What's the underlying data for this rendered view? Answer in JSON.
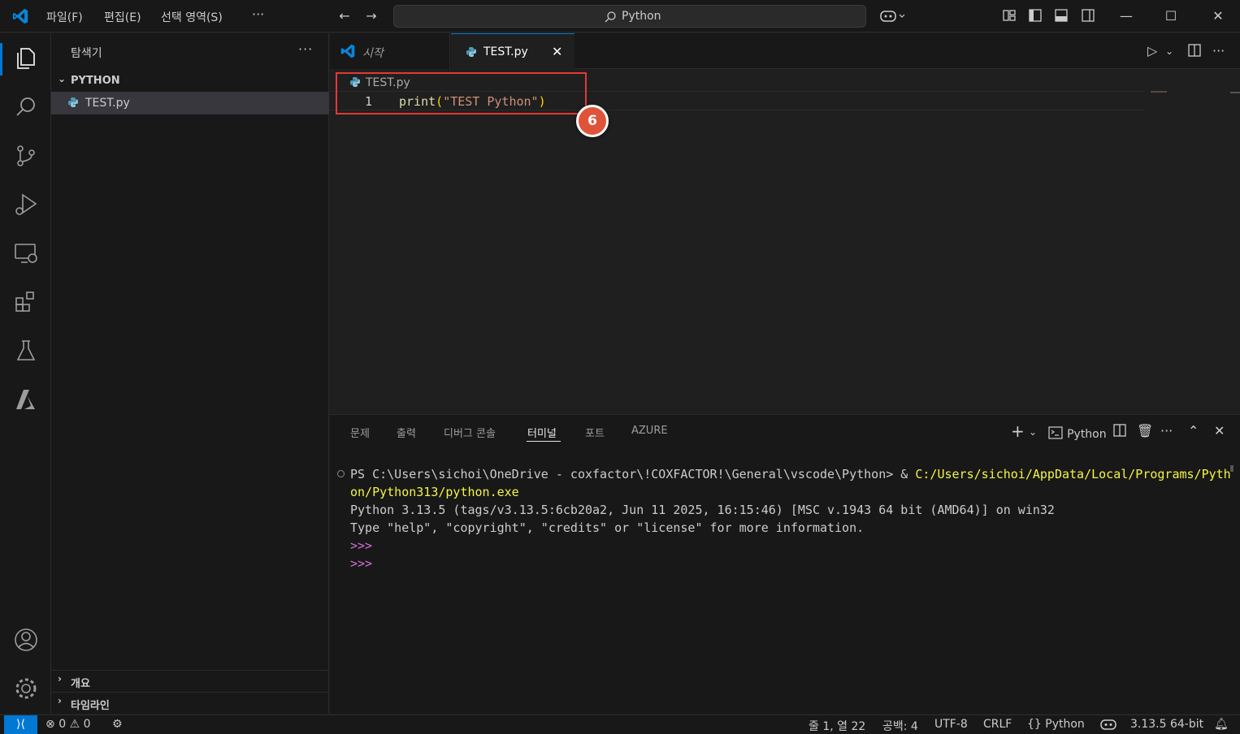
{
  "titlebar": {
    "menus": [
      "파일(F)",
      "편집(E)",
      "선택 영역(S)"
    ],
    "more": "···",
    "search_label": "Python",
    "icons": [
      "vscode-logo",
      "back-arrow-icon",
      "forward-arrow-icon",
      "search-icon",
      "copilot-icon",
      "customize-layout-icon",
      "toggle-sidebar-icon",
      "toggle-panel-icon",
      "toggle-secondary-sidebar-icon",
      "minimize-icon",
      "maximize-icon",
      "close-icon"
    ]
  },
  "activitybar": {
    "items": [
      "explorer-icon",
      "search-icon",
      "source-control-icon",
      "run-debug-icon",
      "remote-explorer-icon",
      "extensions-icon",
      "testing-icon",
      "azure-icon",
      "accounts-icon",
      "settings-gear-icon"
    ]
  },
  "sidebar": {
    "title": "탐색기",
    "more": "···",
    "folder": "PYTHON",
    "file": "TEST.py",
    "outline": "개요",
    "timeline": "타임라인"
  },
  "editor": {
    "tabs": [
      {
        "label": "시작",
        "active": false
      },
      {
        "label": "TEST.py",
        "active": true
      }
    ],
    "breadcrumb": "TEST.py",
    "line_number": "1",
    "code": {
      "fn": "print",
      "open": "(",
      "str": "\"TEST Python\"",
      "close": ")"
    },
    "annotation_badge": "6"
  },
  "panel": {
    "tabs": [
      "문제",
      "출력",
      "디버그 콘솔",
      "터미널",
      "포트",
      "AZURE"
    ],
    "active_tab": "터미널",
    "terminal_profile": "Python",
    "terminal": {
      "line1_prompt": "PS C:\\Users\\sichoi\\OneDrive - coxfactor\\!COXFACTOR!\\General\\vscode\\Python> & ",
      "line1_cmd": "C:/Users/sichoi/AppData/Local/Programs/Pyth",
      "line2_cmd": "on/Python313/python.exe",
      "line3": "Python 3.13.5 (tags/v3.13.5:6cb20a2, Jun 11 2025, 16:15:46) [MSC v.1943 64 bit (AMD64)] on win32",
      "line4": "Type \"help\", \"copyright\", \"credits\" or \"license\" for more information.",
      "prompt1": ">>>",
      "prompt2": ">>>"
    }
  },
  "statusbar": {
    "errors": "0",
    "warnings": "0",
    "cursor": "줄 1, 열 22",
    "spaces": "공백: 4",
    "encoding": "UTF-8",
    "eol": "CRLF",
    "language": "Python",
    "interpreter": "3.13.5 64-bit"
  },
  "colors": {
    "accent": "#0078d4",
    "highlight_box": "#e53935",
    "badge": "#e0533b"
  }
}
